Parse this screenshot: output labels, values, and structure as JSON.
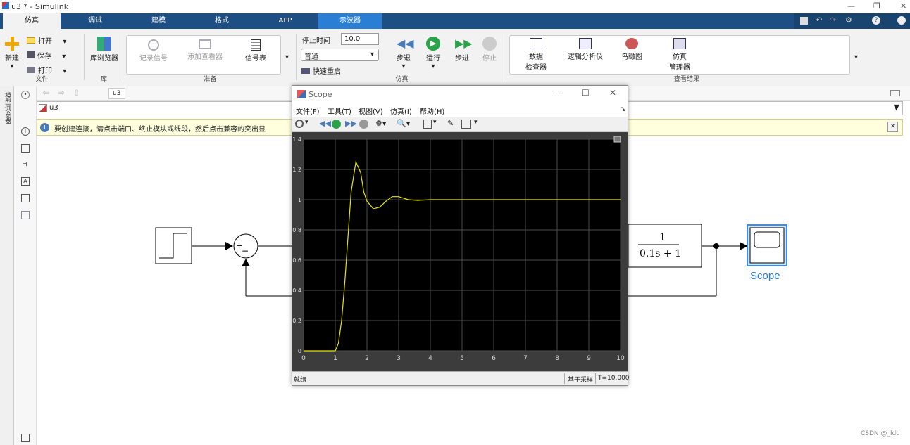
{
  "window": {
    "title": "u3 * - Simulink"
  },
  "tabs": [
    "仿真",
    "调试",
    "建模",
    "格式",
    "APP",
    "示波器"
  ],
  "ribbon": {
    "file": {
      "new": "新建",
      "open": "打开",
      "save": "保存",
      "print": "打印",
      "label": "文件"
    },
    "library": {
      "browser": "库浏览器",
      "label": "库"
    },
    "prepare": {
      "log_signals": "记录信号",
      "add_viewer": "添加查看器",
      "signal_table": "信号表",
      "label": "准备"
    },
    "simulate": {
      "stop_time_label": "停止时间",
      "stop_time": "10.0",
      "mode": "普通",
      "fast_restart": "快速重启",
      "step_back": "步退",
      "run": "运行",
      "step_forward": "步进",
      "stop": "停止",
      "label": "仿真"
    },
    "review": {
      "data_inspector_1": "数据",
      "data_inspector_2": "检查器",
      "logic_analyzer": "逻辑分析仪",
      "birdseye": "鸟瞰图",
      "sim_manager_1": "仿真",
      "sim_manager_2": "管理器",
      "label": "查看结果"
    }
  },
  "side_label": "模型浏览器",
  "nav": {
    "breadcrumb": "u3"
  },
  "address": {
    "model": "u3"
  },
  "hint": {
    "text": "要创建连接，请点击端口、终止模块或线段，然后点击兼容的突出显"
  },
  "blocks": {
    "sum_plus": "+",
    "sum_minus": "−",
    "tf_num": "1",
    "tf_den": "0.1s + 1",
    "scope_label": "Scope"
  },
  "scope": {
    "title": "Scope",
    "menu": [
      "文件(F)",
      "工具(T)",
      "视图(V)",
      "仿真(I)",
      "帮助(H)"
    ],
    "status_ready": "就绪",
    "status_sample": "基于采样",
    "status_time": "T=10.000"
  },
  "watermark": "CSDN @_ldc",
  "chart_data": {
    "type": "line",
    "xlim": [
      0,
      10
    ],
    "ylim": [
      0,
      1.4
    ],
    "xticks": [
      "0",
      "1",
      "2",
      "3",
      "4",
      "5",
      "6",
      "7",
      "8",
      "9",
      "10"
    ],
    "yticks": [
      "0",
      "0.2",
      "0.4",
      "0.6",
      "0.8",
      "1",
      "1.2",
      "1.4"
    ],
    "grid": true,
    "series": [
      {
        "color": "#e6e600",
        "x": [
          0,
          1.0,
          1.1,
          1.2,
          1.3,
          1.4,
          1.5,
          1.65,
          1.8,
          1.9,
          2.0,
          2.2,
          2.4,
          2.6,
          2.8,
          3.0,
          3.3,
          3.6,
          4.0,
          4.5,
          5,
          6,
          7,
          8,
          9,
          10
        ],
        "y": [
          0,
          0,
          0.05,
          0.2,
          0.45,
          0.75,
          1.05,
          1.25,
          1.18,
          1.05,
          0.99,
          0.94,
          0.95,
          0.99,
          1.02,
          1.02,
          1.0,
          0.995,
          1.0,
          1.0,
          1.0,
          1.0,
          1.0,
          1.0,
          1.0,
          1.0
        ]
      }
    ]
  },
  "colors": {
    "ribbon_bar": "#1d4f84",
    "scope_tab": "#2a7fd4",
    "plot_bg": "#000000",
    "trace": "#e6e600"
  }
}
